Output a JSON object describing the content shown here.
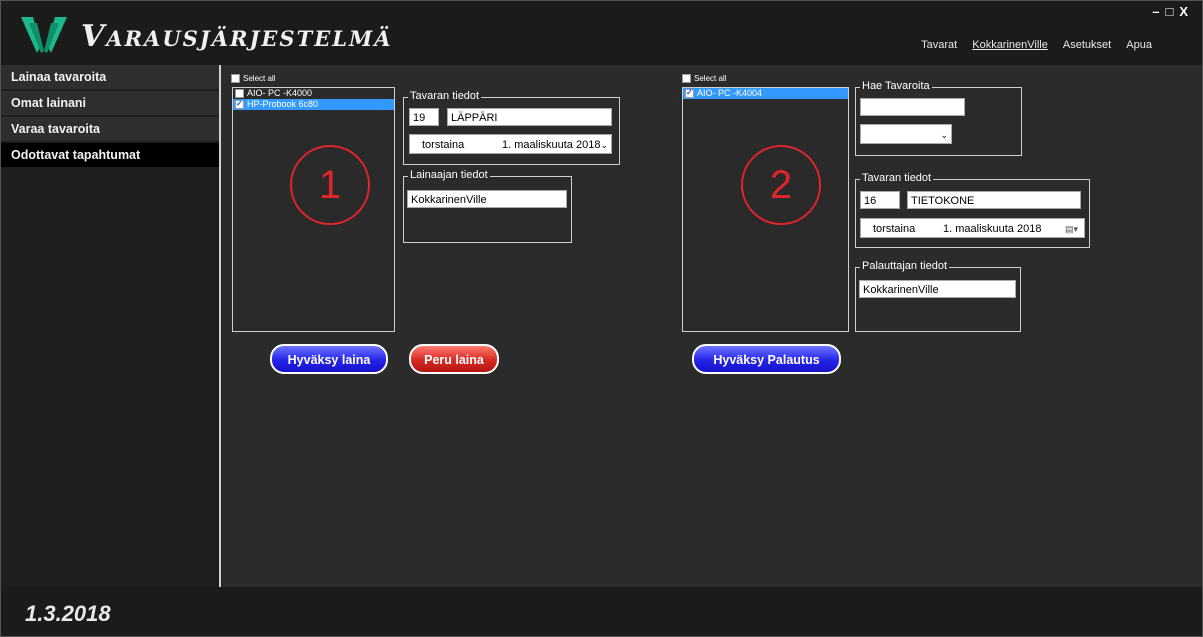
{
  "app": {
    "title": "Varausjärjestelmä",
    "date": "1.3.2018"
  },
  "topnav": [
    "Tavarat",
    "KokkarinenVille",
    "Asetukset",
    "Apua"
  ],
  "window_controls": {
    "minimize": "–",
    "maximize": "□",
    "close": "X"
  },
  "sidebar": [
    "Lainaa tavaroita",
    "Omat lainani",
    "Varaa tavaroita",
    "Odottavat tapahtumat"
  ],
  "panel1": {
    "select_all": "Select all",
    "items": [
      {
        "label": "AIO- PC -K4000",
        "checked": false,
        "selected": false
      },
      {
        "label": "HP-Probook 6c80",
        "checked": true,
        "selected": true
      }
    ],
    "marker": "1",
    "item_group": {
      "title": "Tavaran tiedot",
      "id": "19",
      "name": "LÄPPÄRI",
      "day": "torstaina",
      "date": "1. maaliskuuta 2018"
    },
    "borrower_group": {
      "title": "Lainaajan tiedot",
      "name": "KokkarinenVille"
    },
    "approve_button": "Hyväksy laina",
    "cancel_button": "Peru laina"
  },
  "panel2": {
    "select_all": "Select all",
    "items": [
      {
        "label": "AIO- PC -K4004",
        "checked": true,
        "selected": true
      }
    ],
    "marker": "2",
    "search_group": {
      "title": "Hae Tavaroita",
      "query": "",
      "filter": ""
    },
    "item_group": {
      "title": "Tavaran tiedot",
      "id": "16",
      "name": "TIETOKONE",
      "day": "torstaina",
      "date": "1. maaliskuuta 2018"
    },
    "returner_group": {
      "title": "Palauttajan tiedot",
      "name": "KokkarinenVille"
    },
    "approve_button": "Hyväksy Palautus"
  },
  "colors": {
    "accent_blue": "#2524e8",
    "accent_red": "#d62a22",
    "selection": "#3399ff",
    "marker": "#e0242a",
    "logo": "#1fb88a"
  }
}
